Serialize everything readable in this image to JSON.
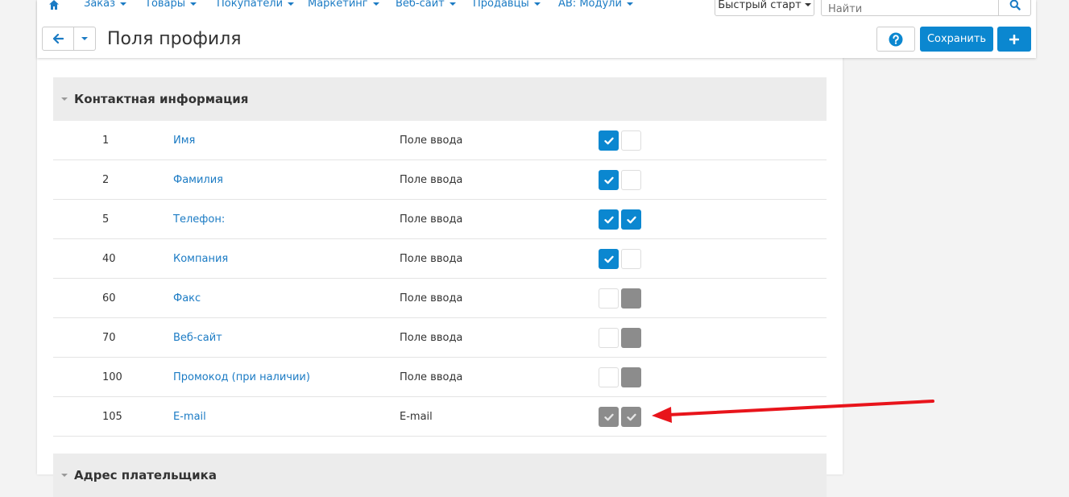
{
  "nav": {
    "items": [
      {
        "label": "Заказ"
      },
      {
        "label": "Товары"
      },
      {
        "label": "Покупатели"
      },
      {
        "label": "Маркетинг"
      },
      {
        "label": "Веб-сайт"
      },
      {
        "label": "Продавцы"
      },
      {
        "label": "АВ: Модули"
      }
    ],
    "quick_start": "Быстрый старт",
    "search_placeholder": "Найти"
  },
  "page": {
    "title": "Поля профиля",
    "save_label": "Сохранить"
  },
  "sections": [
    {
      "title": "Контактная информация",
      "rows": [
        {
          "pos": "1",
          "name": "Имя",
          "type": "Поле ввода",
          "profile": "checked",
          "checkout": "unchecked"
        },
        {
          "pos": "2",
          "name": "Фамилия",
          "type": "Поле ввода",
          "profile": "checked",
          "checkout": "unchecked"
        },
        {
          "pos": "5",
          "name": "Телефон:",
          "type": "Поле ввода",
          "profile": "checked",
          "checkout": "checked"
        },
        {
          "pos": "40",
          "name": "Компания",
          "type": "Поле ввода",
          "profile": "checked",
          "checkout": "unchecked"
        },
        {
          "pos": "60",
          "name": "Факс",
          "type": "Поле ввода",
          "profile": "unchecked",
          "checkout": "disabled"
        },
        {
          "pos": "70",
          "name": "Веб-сайт",
          "type": "Поле ввода",
          "profile": "unchecked",
          "checkout": "disabled"
        },
        {
          "pos": "100",
          "name": "Промокод (при наличии)",
          "type": "Поле ввода",
          "profile": "unchecked",
          "checkout": "disabled"
        },
        {
          "pos": "105",
          "name": "E-mail",
          "type": "E-mail",
          "profile": "disabled-checked",
          "checkout": "disabled-checked"
        }
      ]
    },
    {
      "title": "Адрес плательщика"
    }
  ],
  "colors": {
    "accent": "#0b87d0",
    "link": "#1b7bc4",
    "disabled": "#8c8c8c",
    "annotation_arrow": "#e8141b"
  }
}
